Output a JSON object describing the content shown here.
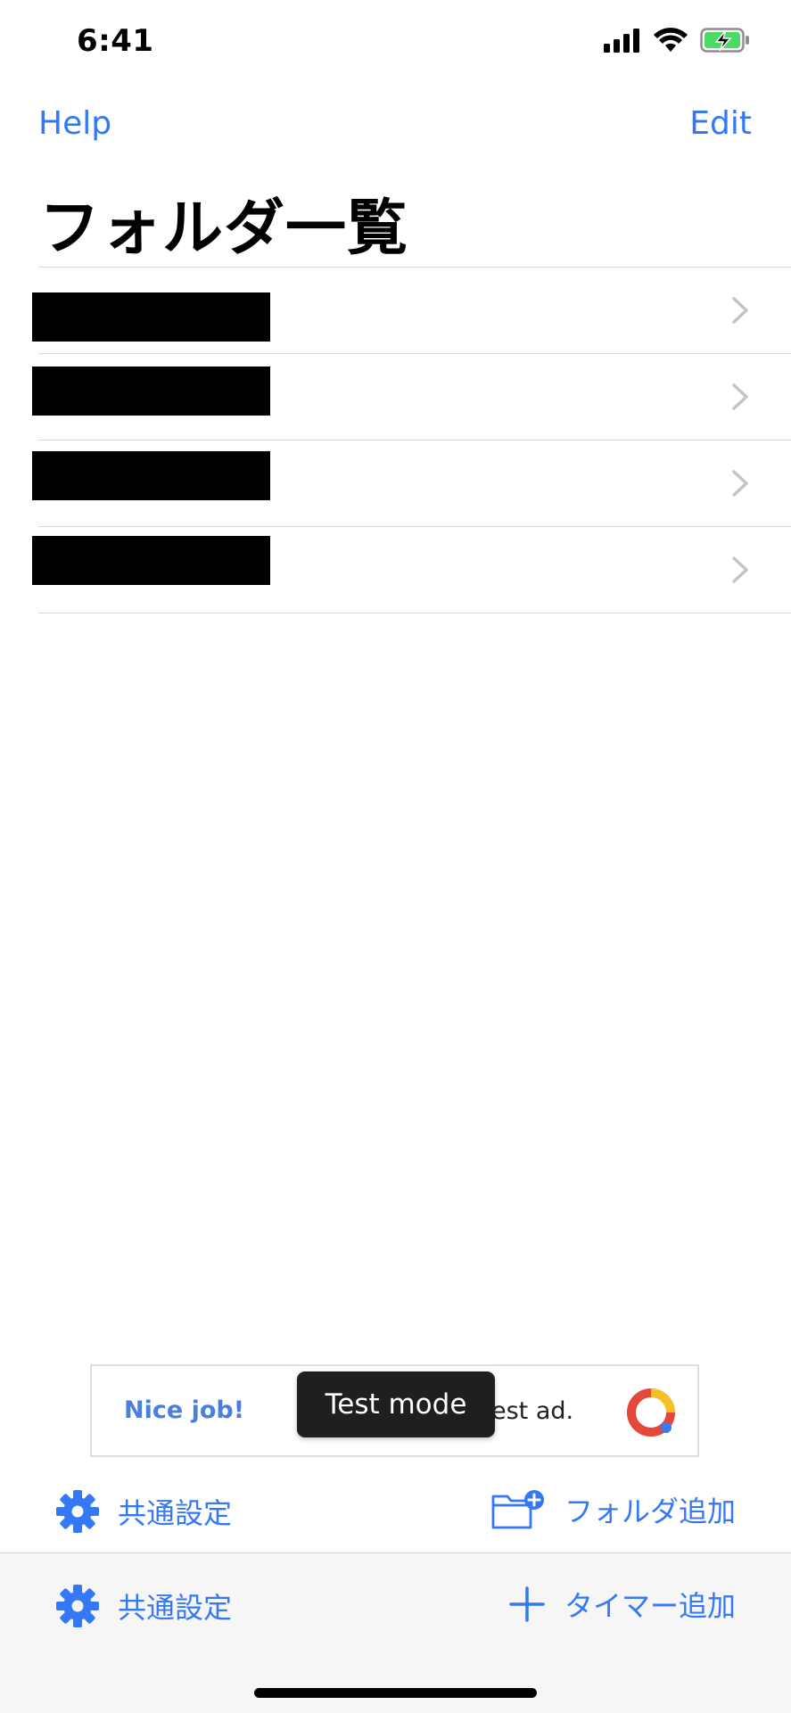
{
  "status_bar": {
    "time": "6:41"
  },
  "nav": {
    "left_label": "Help",
    "right_label": "Edit"
  },
  "page": {
    "title": "フォルダ一覧"
  },
  "folders": [
    {
      "name": ""
    },
    {
      "name": ""
    },
    {
      "name": ""
    },
    {
      "name": ""
    }
  ],
  "ad": {
    "left_text": "Nice job!",
    "right_text": "est ad.",
    "overlay_label": "Test mode"
  },
  "actions": {
    "common_settings_label": "共通設定",
    "add_folder_label": "フォルダ追加",
    "add_timer_label": "タイマー追加"
  },
  "colors": {
    "accent": "#3478F6",
    "battery_green": "#4CD964",
    "ad_logo_red": "#E3483A",
    "ad_logo_yellow": "#F6BE2A",
    "ad_logo_blue": "#3B7BF0"
  }
}
